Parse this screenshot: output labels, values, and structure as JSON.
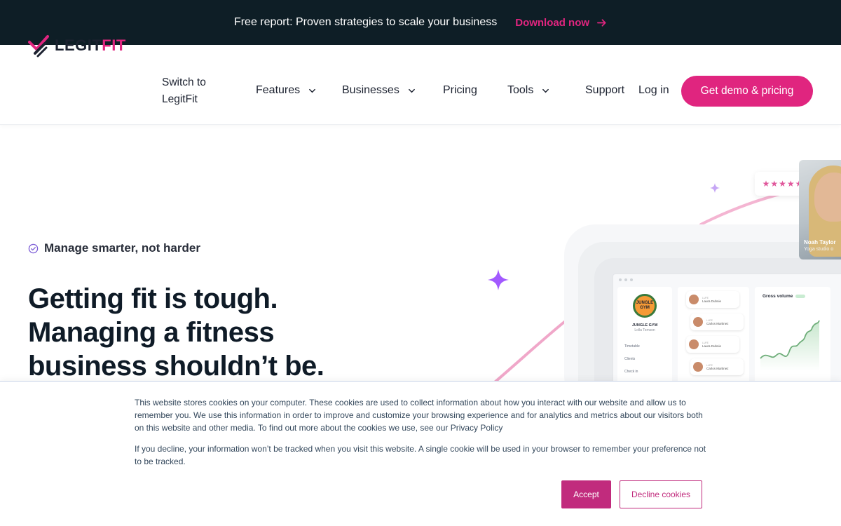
{
  "banner": {
    "text": "Free report: Proven strategies to scale your business",
    "link_label": "Download now",
    "link_icon": "arrow-right-icon"
  },
  "nav": {
    "logo_part1": "LEGIT",
    "logo_part2": "FIT",
    "switch_label": "Switch to LegitFit",
    "features_label": "Features",
    "businesses_label": "Businesses",
    "pricing_label": "Pricing",
    "tools_label": "Tools",
    "support_label": "Support",
    "login_label": "Log in",
    "cta_label": "Get demo & pricing",
    "dropdown_icon": "chevron-down-icon"
  },
  "hero": {
    "eyebrow": "Manage smarter, not harder",
    "headline_line1": "Getting fit is tough.",
    "headline_line2": "Managing a fitness",
    "headline_line3": "business shouldn’t be."
  },
  "illustration": {
    "gym_logo_text": "JUNGLE GYM",
    "gym_name": "JUNGLE GYM",
    "gym_owner": "Lolla Tomson",
    "menu": [
      "Timetable",
      "Clients",
      "Check in"
    ],
    "clients": [
      {
        "tag": "LUFE",
        "name": "Laura Dubnie"
      },
      {
        "tag": "LUFE",
        "name": "Carlos Martinez"
      },
      {
        "tag": "LUFE",
        "name": "Laura Dubnie"
      },
      {
        "tag": "LUFE",
        "name": "Carlos Martinez"
      }
    ],
    "gross_volume_title": "Gross volume",
    "rating_stars": "★★★★★",
    "testimonial_name": "Noah Taylor",
    "testimonial_sub": "Yoga studio o"
  },
  "cookie": {
    "paragraph1": "This website stores cookies on your computer. These cookies are used to collect information about how you interact with our website and allow us to remember you. We use this information in order to improve and customize your browsing experience and for analytics and metrics about our visitors both on this website and other media. To find out more about the cookies we use, see our Privacy Policy",
    "paragraph2": "If you decline, your information won’t be tracked when you visit this website. A single cookie will be used in your browser to remember your preference not to be tracked.",
    "accept_label": "Accept",
    "decline_label": "Decline cookies"
  },
  "colors": {
    "brand_pink": "#e0257f",
    "banner_bg": "#0e1e26",
    "cookie_accent": "#c12b7d",
    "sparkle_purple": "#a259ff"
  }
}
